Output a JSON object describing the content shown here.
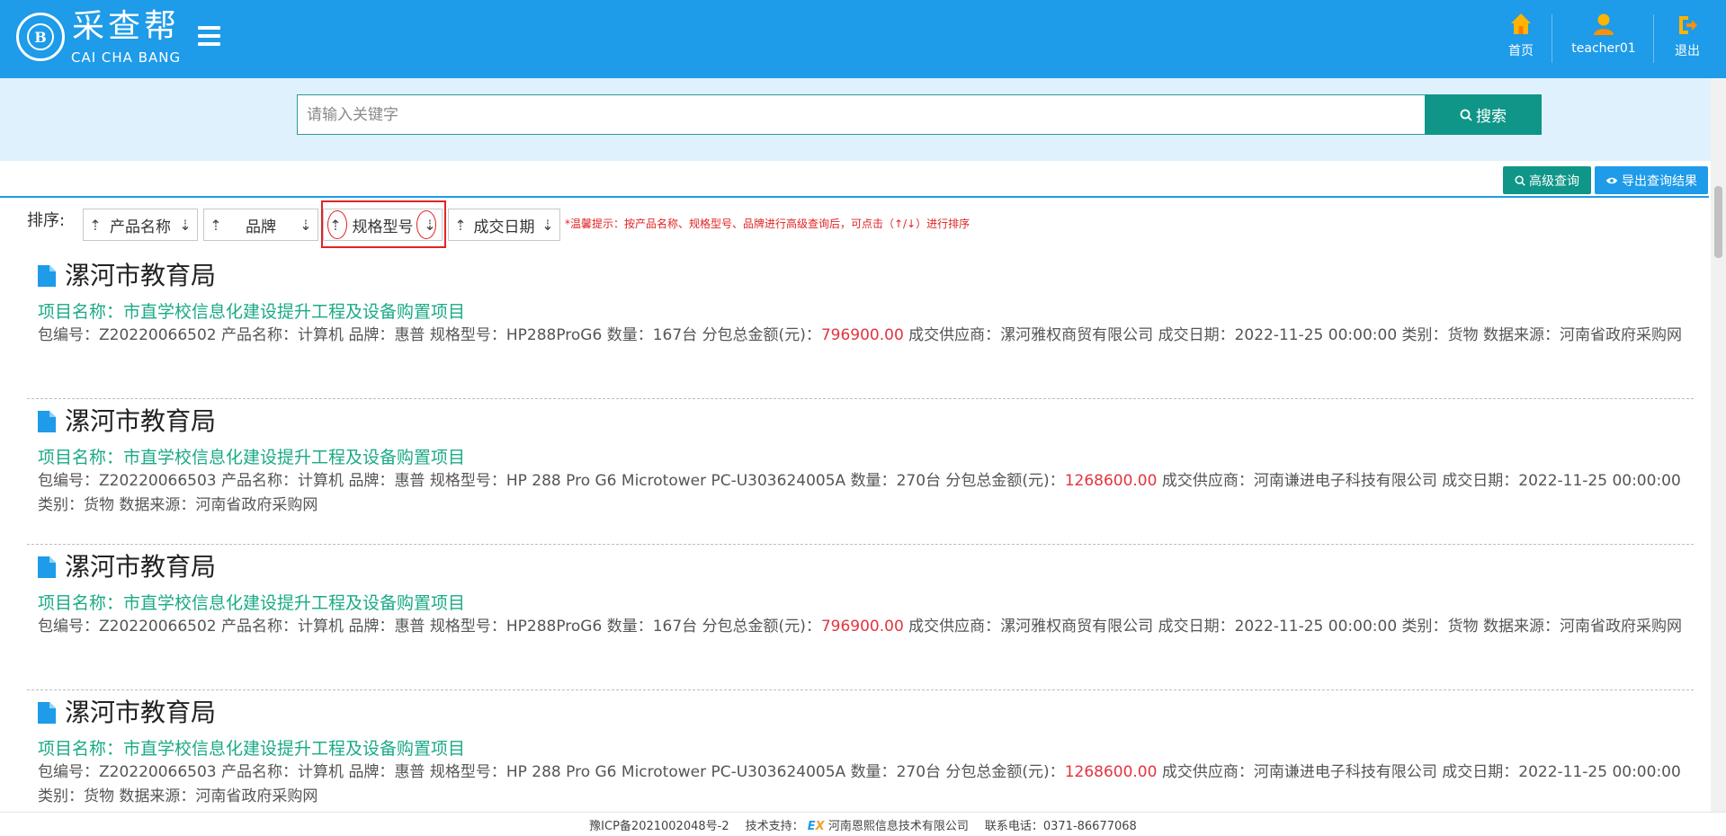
{
  "header": {
    "logo_letter": "B",
    "brand_cn": "采查帮",
    "brand_en": "CAI CHA BANG",
    "nav": [
      {
        "label": "首页",
        "icon": "home-icon"
      },
      {
        "label": "teacher01",
        "icon": "user-icon"
      },
      {
        "label": "退出",
        "icon": "logout-icon"
      }
    ]
  },
  "search": {
    "placeholder": "请输入关键字",
    "value": "",
    "button_label": "搜索"
  },
  "tools": {
    "advanced_label": "高级查询",
    "export_label": "导出查询结果"
  },
  "sort": {
    "label": "排序:",
    "up": "⇡",
    "down": "⇣",
    "fields": [
      "产品名称",
      "品牌",
      "规格型号",
      "成交日期"
    ],
    "tip": "*温馨提示：按产品名称、规格型号、品牌进行高级查询后，可点击（↑/↓）进行排序"
  },
  "labels": {
    "project": "项目名称：",
    "package_no": "包编号：",
    "product": "产品名称：",
    "brand": "品牌：",
    "model": "规格型号：",
    "quantity": "数量：",
    "amount": "分包总金额(元)：",
    "supplier": "成交供应商：",
    "date": "成交日期：",
    "category": "类别：",
    "source": "数据来源："
  },
  "results": [
    {
      "org": "漯河市教育局",
      "project": "市直学校信息化建设提升工程及设备购置项目",
      "package_no": "Z20220066502",
      "product": "计算机",
      "brand": "惠普",
      "model": "HP288ProG6",
      "quantity": "167台",
      "amount": "796900.00",
      "supplier": "漯河雅权商贸有限公司",
      "date": "2022-11-25 00:00:00",
      "category": "货物",
      "source": "河南省政府采购网"
    },
    {
      "org": "漯河市教育局",
      "project": "市直学校信息化建设提升工程及设备购置项目",
      "package_no": "Z20220066503",
      "product": "计算机",
      "brand": "惠普",
      "model": "HP 288 Pro G6 Microtower PC-U303624005A",
      "quantity": "270台",
      "amount": "1268600.00",
      "supplier": "河南谦进电子科技有限公司",
      "date": "2022-11-25 00:00:00",
      "category": "货物",
      "source": "河南省政府采购网"
    },
    {
      "org": "漯河市教育局",
      "project": "市直学校信息化建设提升工程及设备购置项目",
      "package_no": "Z20220066502",
      "product": "计算机",
      "brand": "惠普",
      "model": "HP288ProG6",
      "quantity": "167台",
      "amount": "796900.00",
      "supplier": "漯河雅权商贸有限公司",
      "date": "2022-11-25 00:00:00",
      "category": "货物",
      "source": "河南省政府采购网"
    },
    {
      "org": "漯河市教育局",
      "project": "市直学校信息化建设提升工程及设备购置项目",
      "package_no": "Z20220066503",
      "product": "计算机",
      "brand": "惠普",
      "model": "HP 288 Pro G6 Microtower PC-U303624005A",
      "quantity": "270台",
      "amount": "1268600.00",
      "supplier": "河南谦进电子科技有限公司",
      "date": "2022-11-25 00:00:00",
      "category": "货物",
      "source": "河南省政府采购网"
    }
  ],
  "footer": {
    "icp": "豫ICP备2021002048号-2",
    "tech_label": "技术支持：",
    "ex_logo_e": "E",
    "ex_logo_x": "X",
    "company": "河南恩熙信息技术有限公司",
    "phone_label": "联系电话：",
    "phone": "0371-86677068"
  },
  "colors": {
    "header_bg": "#1e9be9",
    "teal": "#0f9688",
    "project_green": "#1aaa86",
    "amount_red": "#e3343f",
    "tip_red": "#e02424"
  }
}
